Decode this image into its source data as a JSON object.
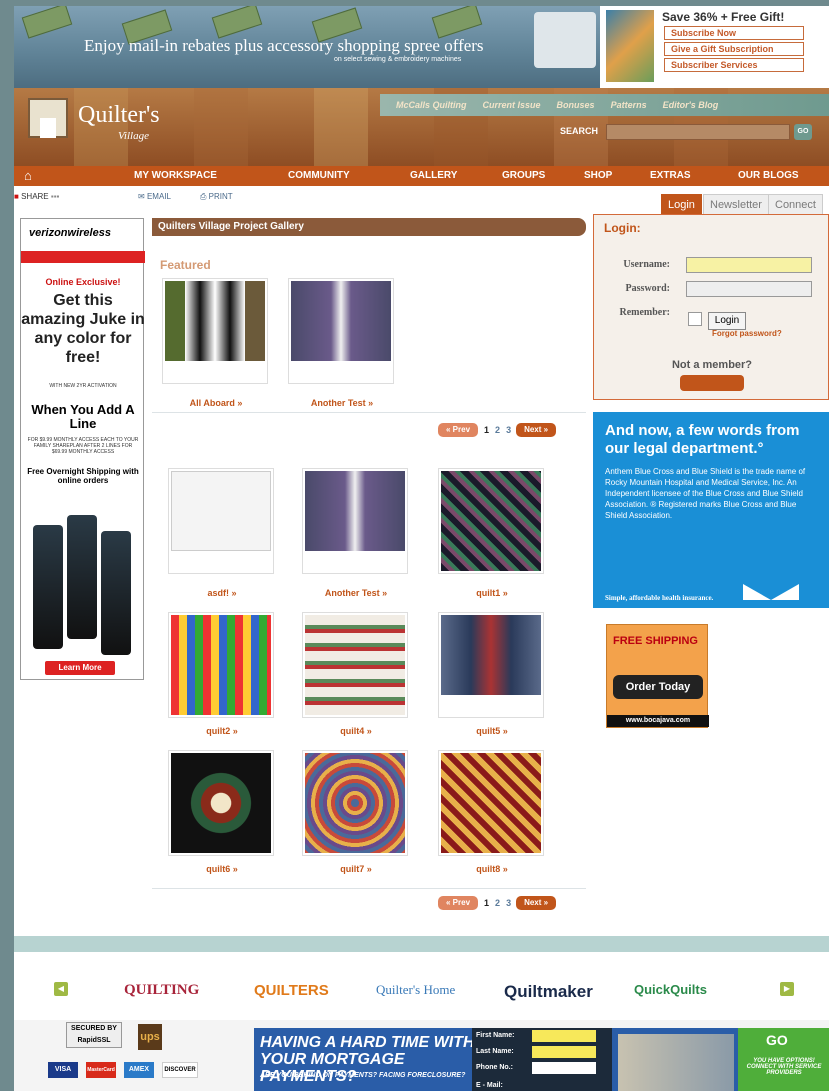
{
  "top_banner": {
    "headline": "Enjoy mail-in rebates plus accessory shopping spree offers",
    "subline": "on select sewing & embroidery machines"
  },
  "mag_ad": {
    "headline": "Save 36% + Free Gift!",
    "links": [
      "Subscribe Now",
      "Give a Gift Subscription",
      "Subscriber Services"
    ]
  },
  "header": {
    "site_name": "Quilter's",
    "site_sub": "Village",
    "top_nav": [
      "McCalls Quilting",
      "Current Issue",
      "Bonuses",
      "Patterns",
      "Editor's Blog"
    ],
    "search_label": "SEARCH",
    "go_label": "GO"
  },
  "main_nav": [
    "MY WORKSPACE",
    "COMMUNITY",
    "GALLERY",
    "GROUPS",
    "SHOP",
    "EXTRAS",
    "OUR BLOGS"
  ],
  "tools": {
    "share": "SHARE",
    "email": "EMAIL",
    "print": "PRINT"
  },
  "login": {
    "tabs": [
      "Login",
      "Newsletter",
      "Connect"
    ],
    "title": "Login:",
    "username_label": "Username:",
    "password_label": "Password:",
    "remember_label": "Remember:",
    "button": "Login",
    "forgot": "Forgot password?",
    "not_member": "Not a member?"
  },
  "blue_ad": {
    "headline": "And now, a few words from our legal department.°",
    "body": "Anthem Blue Cross and Blue Shield is the trade name of Rocky Mountain Hospital and Medical Service, Inc. An Independent licensee of the Blue Cross and Blue Shield Association. ® Registered marks Blue Cross and Blue Shield Association.",
    "slogan": "Simple, affordable health insurance."
  },
  "boca_ad": {
    "free_shipping": "FREE SHIPPING",
    "order": "Order Today",
    "url": "www.bocajava.com"
  },
  "verizon_ad": {
    "logo": "verizonwireless",
    "exclusive": "Online Exclusive!",
    "headline": "Get this amazing Juke in any color for free!",
    "fine1": "WITH NEW 2YR ACTIVATION",
    "add": "When You Add A Line",
    "fine2": "FOR $9.99 MONTHLY ACCESS EACH TO YOUR FAMILY SHAREPLAN AFTER 2 LINES FOR $69.99 MONTHLY ACCESS",
    "shipping": "Free Overnight Shipping with online orders",
    "learn": "Learn More"
  },
  "gallery": {
    "title": "Quilters Village Project Gallery",
    "featured_label": "Featured",
    "featured": [
      "All Aboard »",
      "Another Test »"
    ],
    "items": [
      "asdf! »",
      "Another Test »",
      "quilt1 »",
      "quilt2 »",
      "quilt4 »",
      "quilt5 »",
      "quilt6 »",
      "quilt7 »",
      "quilt8 »"
    ],
    "pager": {
      "prev": "« Prev",
      "pages": [
        "1",
        "2",
        "3"
      ],
      "next": "Next »"
    }
  },
  "footer": {
    "logos": [
      "QUILTING",
      "QUILTERS",
      "Quilter's Home",
      "Quiltmaker",
      "QuickQuilts"
    ],
    "secured": "SECURED BY RapidSSL",
    "ups": "ups",
    "cards": [
      "VISA",
      "MasterCard",
      "AMEX",
      "DISCOVER"
    ],
    "mortgage": {
      "headline": "HAVING A HARD TIME WITH YOUR MORTGAGE PAYMENTS?",
      "sub": "ARE YOU BEHIND ON PAYMENTS? FACING FORECLOSURE?",
      "fields": [
        "First Name:",
        "Last Name:",
        "Phone No.:",
        "E - Mail:"
      ],
      "go": "GO",
      "tagline": "YOU HAVE OPTIONS! CONNECT WITH SERVICE PROVIDERS"
    }
  }
}
